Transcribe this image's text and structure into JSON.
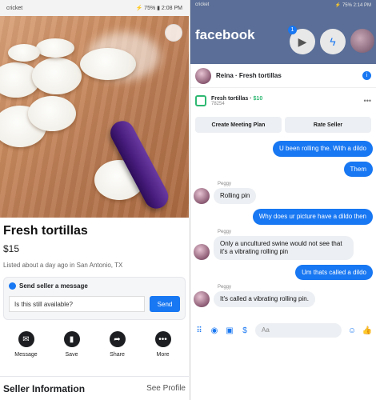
{
  "left": {
    "status": {
      "carrier": "cricket",
      "right": "⚡ 75% ▮ 2:08 PM"
    },
    "listing": {
      "title": "Fresh tortillas",
      "price": "$15",
      "meta": "Listed about a day ago in San Antonio, TX"
    },
    "message_box": {
      "heading": "Send seller a message",
      "field_value": "Is this still available?",
      "send_label": "Send"
    },
    "actions": [
      {
        "label": "Message",
        "icon": "messenger-icon"
      },
      {
        "label": "Save",
        "icon": "bookmark-icon"
      },
      {
        "label": "Share",
        "icon": "share-icon"
      },
      {
        "label": "More",
        "icon": "more-icon"
      }
    ],
    "seller": {
      "heading": "Seller Information",
      "link": "See Profile"
    }
  },
  "right": {
    "status": {
      "carrier": "cricket",
      "right": "⚡ 75% 2:14 PM"
    },
    "logo": "facebook",
    "badge": "1",
    "chat_header": {
      "name": "Reina · Fresh tortillas"
    },
    "product": {
      "name": "Fresh tortillas",
      "price": "$10",
      "sub": "78254"
    },
    "buttons": {
      "meeting": "Create Meeting Plan",
      "rate": "Rate Seller"
    },
    "messages": [
      {
        "dir": "out",
        "text": "U been rolling the. With a dildo"
      },
      {
        "dir": "out",
        "text": "Them"
      },
      {
        "dir": "in",
        "sender": "Peggy",
        "text": "Rolling pin"
      },
      {
        "dir": "out",
        "text": "Why does ur picture have a dildo then"
      },
      {
        "dir": "in",
        "sender": "Peggy",
        "text": "Only a uncultured swine would not see that it's a vibrating rolling pin"
      },
      {
        "dir": "out",
        "text": "Um thats called a dildo"
      },
      {
        "dir": "in",
        "sender": "Peggy",
        "text": "It's called a vibrating rolling pin."
      }
    ],
    "composer": {
      "placeholder": "Aa"
    }
  }
}
